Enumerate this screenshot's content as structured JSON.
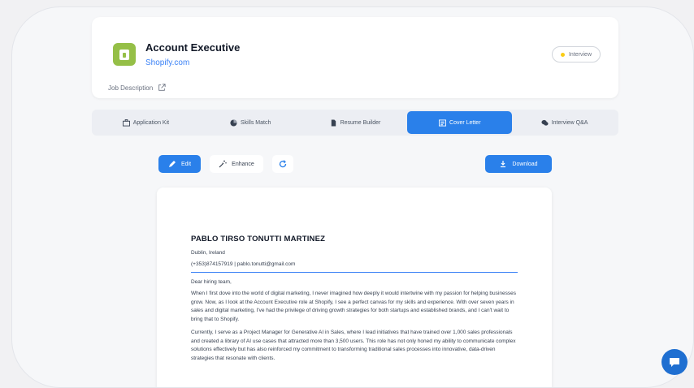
{
  "job": {
    "title": "Account Executive",
    "company": "Shopify.com",
    "description_label": "Job Description",
    "status": "Interview",
    "status_color": "#facc15",
    "logo_color": "#95bf47"
  },
  "tabs": [
    {
      "label": "Application Kit",
      "icon": "briefcase-icon"
    },
    {
      "label": "Skills Match",
      "icon": "pie-chart-icon"
    },
    {
      "label": "Resume Builder",
      "icon": "document-icon"
    },
    {
      "label": "Cover Letter",
      "icon": "letter-icon",
      "active": true
    },
    {
      "label": "Interview Q&A",
      "icon": "chat-bubbles-icon"
    }
  ],
  "toolbar": {
    "edit_label": "Edit",
    "enhance_label": "Enhance",
    "download_label": "Download"
  },
  "letter": {
    "name": "PABLO TIRSO TONUTTI MARTINEZ",
    "location": "Dublin, Ireland",
    "contact": "(+353)874157919 | pablo.tonutti@gmail.com",
    "salutation": "Dear hiring team,",
    "paragraphs": [
      "When I first dove into the world of digital marketing, I never imagined how deeply it would intertwine with my passion for helping businesses grow. Now, as I look at the Account Executive role at Shopify, I see a perfect canvas for my skills and experience. With over seven years in sales and digital marketing, I've had the privilege of driving growth strategies for both startups and established brands, and I can't wait to bring that to Shopify.",
      "Currently, I serve as a Project Manager for Generative AI in Sales, where I lead initiatives that have trained over 1,000 sales professionals and created a library of AI use cases that attracted more than 3,500 users. This role has not only honed my ability to communicate complex solutions effectively but has also reinforced my commitment to transforming traditional sales processes into innovative, data-driven strategies that resonate with clients."
    ]
  },
  "colors": {
    "accent": "#2a80ea",
    "link": "#3b82f6"
  }
}
